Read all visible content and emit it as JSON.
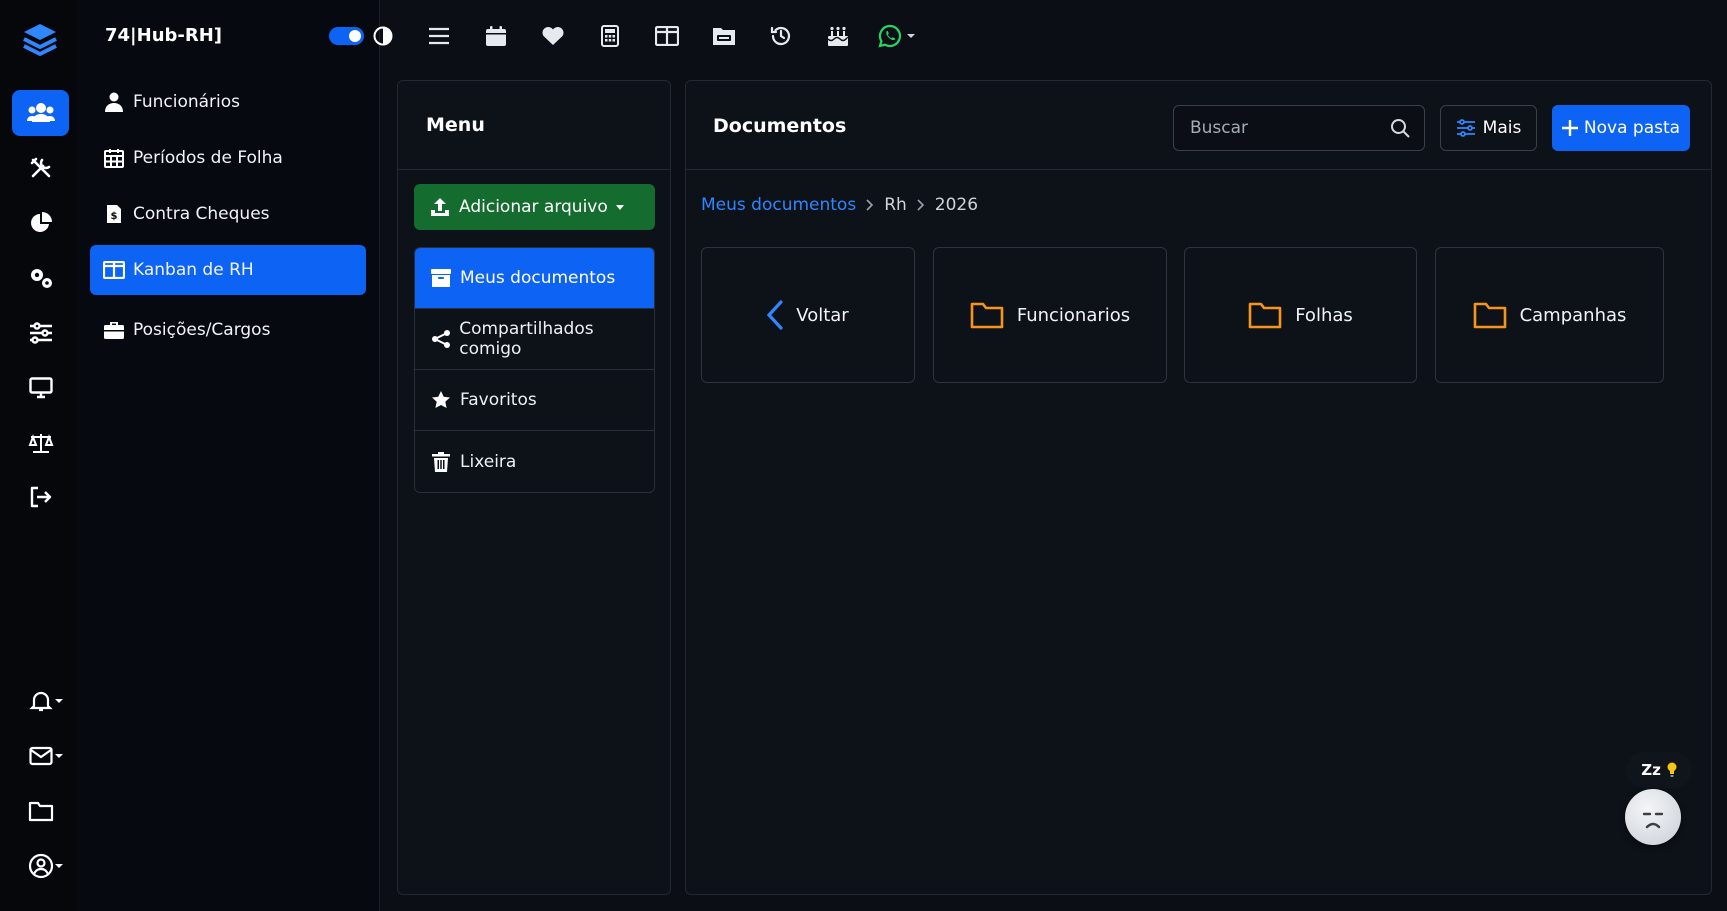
{
  "app": {
    "workspace_title": "74|Hub-RH]"
  },
  "rail": {
    "items": [
      {
        "icon": "users-icon",
        "active": true
      },
      {
        "icon": "tools-icon"
      },
      {
        "icon": "pie-chart-icon"
      },
      {
        "icon": "cogs-icon"
      },
      {
        "icon": "sliders-icon"
      },
      {
        "icon": "monitor-icon"
      },
      {
        "icon": "scale-icon"
      },
      {
        "icon": "logout-icon"
      }
    ],
    "bottom": [
      {
        "icon": "bell-icon"
      },
      {
        "icon": "mail-icon"
      },
      {
        "icon": "folder-icon"
      },
      {
        "icon": "user-circle-icon"
      }
    ]
  },
  "sidebar": {
    "items": [
      {
        "label": "Funcionários",
        "icon": "user-icon"
      },
      {
        "label": "Períodos de Folha",
        "icon": "calendar-grid-icon"
      },
      {
        "label": "Contra Cheques",
        "icon": "invoice-icon"
      },
      {
        "label": "Kanban de RH",
        "icon": "columns-icon",
        "active": true
      },
      {
        "label": "Posições/Cargos",
        "icon": "briefcase-icon"
      }
    ]
  },
  "toolbar": {
    "icons": [
      "menu-icon",
      "calendar-icon",
      "heart-icon",
      "calculator-icon",
      "columns-icon",
      "folder-open-icon",
      "history-icon",
      "birthday-cake-icon",
      "whatsapp-icon"
    ]
  },
  "menu_panel": {
    "title": "Menu",
    "add_button": "Adicionar arquivo",
    "items": [
      {
        "label": "Meus documentos",
        "icon": "archive-icon",
        "active": true
      },
      {
        "label": "Compartilhados comigo",
        "icon": "share-icon"
      },
      {
        "label": "Favoritos",
        "icon": "star-icon"
      },
      {
        "label": "Lixeira",
        "icon": "trash-icon"
      }
    ]
  },
  "documents": {
    "title": "Documentos",
    "search_placeholder": "Buscar",
    "more_button": "Mais",
    "new_folder_button": "Nova pasta",
    "breadcrumb": {
      "root": "Meus documentos",
      "level1": "Rh",
      "level2": "2026"
    },
    "back_label": "Voltar",
    "folders": [
      {
        "name": "Funcionarios"
      },
      {
        "name": "Folhas"
      },
      {
        "name": "Campanhas"
      }
    ]
  },
  "widget": {
    "badge_text": "Zz"
  },
  "colors": {
    "accent": "#0d63f3",
    "success": "#146c2e",
    "folder": "#f7941d",
    "link": "#2f86ff"
  }
}
